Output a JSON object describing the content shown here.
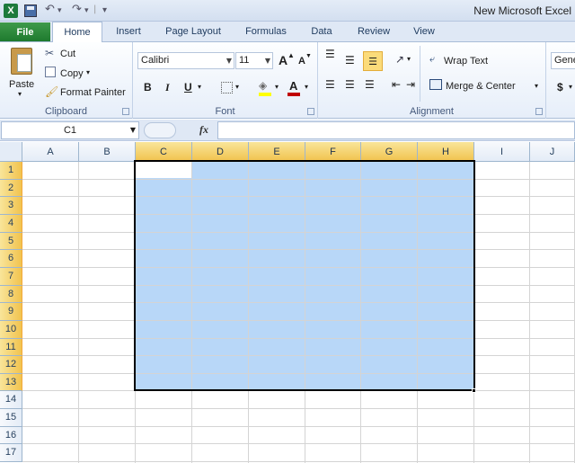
{
  "title_bar": {
    "logo_letter": "X",
    "app_title": "New Microsoft Excel",
    "undo": "↶",
    "redo": "↷",
    "qat_more": "▾"
  },
  "tabs": [
    "File",
    "Home",
    "Insert",
    "Page Layout",
    "Formulas",
    "Data",
    "Review",
    "View"
  ],
  "ribbon": {
    "clipboard": {
      "label": "Clipboard",
      "paste": "Paste",
      "cut": "Cut",
      "copy": "Copy",
      "format_painter": "Format Painter"
    },
    "font": {
      "label": "Font",
      "font_name": "Calibri",
      "font_size": "11",
      "grow": "A",
      "shrink": "A",
      "bold": "B",
      "italic": "I",
      "underline": "U",
      "font_color": "A"
    },
    "alignment": {
      "label": "Alignment",
      "wrap_text": "Wrap Text",
      "merge_center": "Merge & Center"
    },
    "number": {
      "format": "Gene",
      "currency": "$"
    }
  },
  "formula_bar": {
    "name_box": "C1",
    "fx": "fx",
    "content": ""
  },
  "grid": {
    "columns": [
      "A",
      "B",
      "C",
      "D",
      "E",
      "F",
      "G",
      "H",
      "I",
      "J"
    ],
    "selected_columns": [
      "C",
      "D",
      "E",
      "F",
      "G",
      "H"
    ],
    "rows": [
      "1",
      "2",
      "3",
      "4",
      "5",
      "6",
      "7",
      "8",
      "9",
      "10",
      "11",
      "12",
      "13",
      "14",
      "15",
      "16",
      "17"
    ],
    "selected_rows": [
      "1",
      "2",
      "3",
      "4",
      "5",
      "6",
      "7",
      "8",
      "9",
      "10",
      "11",
      "12",
      "13"
    ],
    "selection_color": "#b8d7f8",
    "header_highlight_color": "#f1c34e"
  }
}
